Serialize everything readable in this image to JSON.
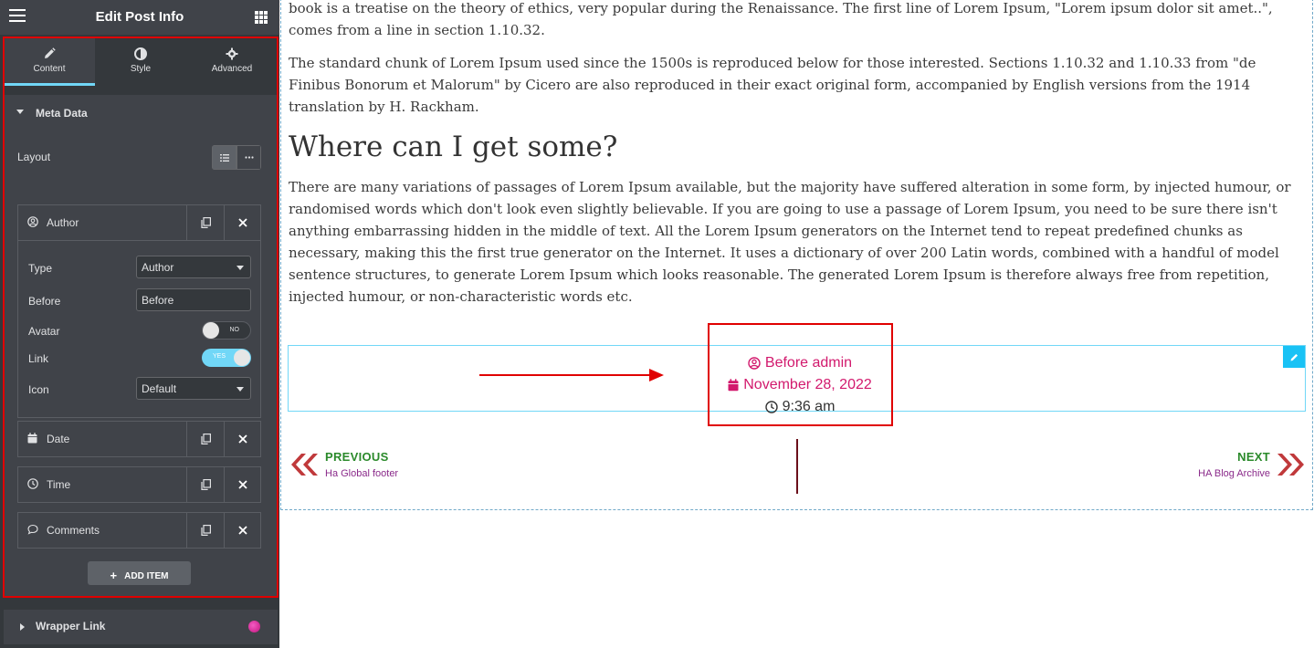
{
  "sidebar": {
    "title": "Edit Post Info",
    "tabs": [
      {
        "label": "Content",
        "icon": "pencil-icon",
        "active": true
      },
      {
        "label": "Style",
        "icon": "half-circle-icon",
        "active": false
      },
      {
        "label": "Advanced",
        "icon": "gear-icon",
        "active": false
      }
    ],
    "section_meta": "Meta Data",
    "layout_label": "Layout",
    "items": [
      {
        "name": "Author",
        "icon": "user-circle-icon"
      },
      {
        "name": "Date",
        "icon": "calendar-icon"
      },
      {
        "name": "Time",
        "icon": "clock-icon"
      },
      {
        "name": "Comments",
        "icon": "comment-icon"
      }
    ],
    "author_fields": {
      "type_label": "Type",
      "type_value": "Author",
      "before_label": "Before",
      "before_value": "Before",
      "avatar_label": "Avatar",
      "avatar_toggle": "NO",
      "link_label": "Link",
      "link_toggle": "YES",
      "icon_label": "Icon",
      "icon_value": "Default"
    },
    "add_item": "ADD ITEM",
    "section_wrapper": "Wrapper Link"
  },
  "preview": {
    "para1": "book is a treatise on the theory of ethics, very popular during the Renaissance. The first line of Lorem Ipsum, \"Lorem ipsum dolor sit amet..\", comes from a line in section 1.10.32.",
    "para2": "The standard chunk of Lorem Ipsum used since the 1500s is reproduced below for those interested. Sections 1.10.32 and 1.10.33 from \"de Finibus Bonorum et Malorum\" by Cicero are also reproduced in their exact original form, accompanied by English versions from the 1914 translation by H. Rackham.",
    "heading": "Where can I get some?",
    "para3": "There are many variations of passages of Lorem Ipsum available, but the majority have suffered alteration in some form, by injected humour, or randomised words which don't look even slightly believable. If you are going to use a passage of Lorem Ipsum, you need to be sure there isn't anything embarrassing hidden in the middle of text. All the Lorem Ipsum generators on the Internet tend to repeat predefined chunks as necessary, making this the first true generator on the Internet. It uses a dictionary of over 200 Latin words, combined with a handful of model sentence structures, to generate Lorem Ipsum which looks reasonable. The generated Lorem Ipsum is therefore always free from repetition, injected humour, or non-characteristic words etc.",
    "meta": {
      "author": "Before admin",
      "date": "November 28, 2022",
      "time": "9:36 am"
    },
    "nav": {
      "prev_label": "PREVIOUS",
      "prev_title": "Ha Global footer",
      "next_label": "NEXT",
      "next_title": "HA Blog Archive"
    }
  },
  "colors": {
    "accent": "#71d7f7",
    "highlight_red": "#e00000",
    "meta_pink": "#d2196d",
    "nav_green": "#2b8a2b",
    "nav_arrow": "#c0393b"
  }
}
